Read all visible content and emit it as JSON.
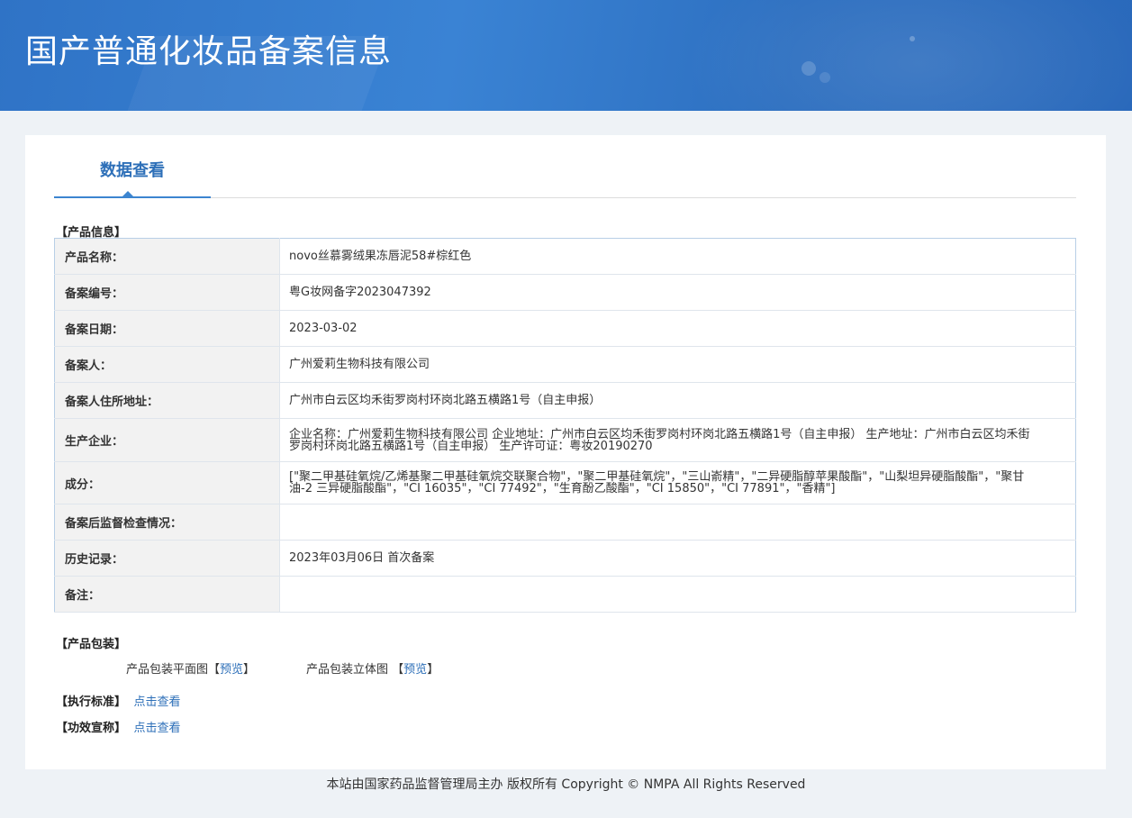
{
  "site": {
    "title": "国产普通化妆品备案信息"
  },
  "tabs": [
    {
      "label": "数据查看"
    }
  ],
  "product_info": {
    "section_label": "【产品信息】",
    "rows": [
      {
        "key": "产品名称：",
        "value": "novo丝慕雾绒果冻唇泥58#棕红色"
      },
      {
        "key": "备案编号：",
        "value": "粤G妆网备字2023047392"
      },
      {
        "key": "备案日期：",
        "value": "2023-03-02"
      },
      {
        "key": "备案人：",
        "value": "广州爱莉生物科技有限公司"
      },
      {
        "key": "备案人住所地址：",
        "value": "广州市白云区均禾街罗岗村环岗北路五横路1号（自主申报）"
      },
      {
        "key": "生产企业：",
        "value": "企业名称：广州爱莉生物科技有限公司 企业地址：广州市白云区均禾街罗岗村环岗北路五横路1号（自主申报） 生产地址：广州市白云区均禾街罗岗村环岗北路五横路1号（自主申报） 生产许可证：粤妆20190270"
      },
      {
        "key": "成分：",
        "value": "[\"聚二甲基硅氧烷/乙烯基聚二甲基硅氧烷交联聚合物\"，\"聚二甲基硅氧烷\"，\"三山嵛精\"，\"二异硬脂醇苹果酸酯\"，\"山梨坦异硬脂酸酯\"，\"聚甘油-2 三异硬脂酸酯\"，\"CI 16035\"，\"CI 77492\"，\"生育酚乙酸酯\"，\"CI 15850\"，\"CI 77891\"，\"香精\"]"
      },
      {
        "key": "备案后监督检查情况：",
        "value": ""
      },
      {
        "key": "历史记录：",
        "value": "2023年03月06日 首次备案"
      },
      {
        "key": "备注：",
        "value": ""
      }
    ]
  },
  "packaging": {
    "section_label": "【产品包装】",
    "flat_label": "产品包装平面图",
    "flat_bracket_open": "【",
    "flat_link": "预览",
    "flat_bracket_close": "】",
    "solid_label": "产品包装立体图",
    "solid_bracket_open": "【",
    "solid_link": "预览",
    "solid_bracket_close": "】"
  },
  "standard": {
    "label": "【执行标准】",
    "link": "点击查看"
  },
  "efficacy": {
    "label": "【功效宣称】",
    "link": "点击查看"
  },
  "footer": {
    "text": "本站由国家药品监督管理局主办 版权所有 Copyright © NMPA All Rights Reserved"
  }
}
